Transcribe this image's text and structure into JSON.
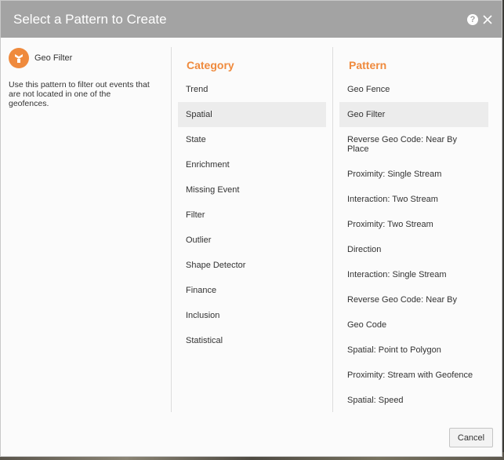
{
  "dialog": {
    "title": "Select a Pattern to Create",
    "help_icon_glyph": "?"
  },
  "selected_pattern": {
    "name": "Geo Filter",
    "description": "Use this pattern to filter out events that are not located in one of the geofences."
  },
  "category": {
    "header": "Category",
    "selected_index": 1,
    "items": [
      "Trend",
      "Spatial",
      "State",
      "Enrichment",
      "Missing Event",
      "Filter",
      "Outlier",
      "Shape Detector",
      "Finance",
      "Inclusion",
      "Statistical"
    ]
  },
  "pattern": {
    "header": "Pattern",
    "selected_index": 1,
    "items": [
      "Geo Fence",
      "Geo Filter",
      "Reverse Geo Code: Near By Place",
      "Proximity: Single Stream",
      "Interaction: Two Stream",
      "Proximity: Two Stream",
      "Direction",
      "Interaction: Single Stream",
      "Reverse Geo Code: Near By",
      "Geo Code",
      "Spatial: Point to Polygon",
      "Proximity: Stream with Geofence",
      "Spatial: Speed"
    ]
  },
  "footer": {
    "cancel_label": "Cancel"
  },
  "colors": {
    "accent": "#ef8a3d",
    "titlebar": "#a3a3a3",
    "selected_row": "#ececec"
  }
}
